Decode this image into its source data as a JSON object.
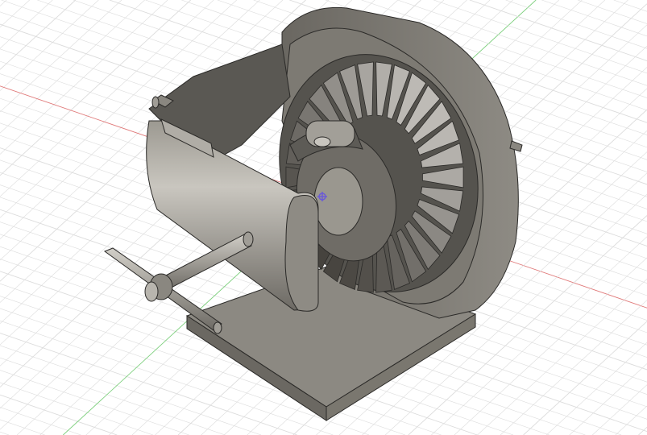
{
  "viewport": {
    "background": "#ffffff",
    "grid_color": "#dcdcdc",
    "x_axis_color": "#e07a7a",
    "y_axis_color": "#7ccf7c",
    "origin_marker_color": "#6b5bd6"
  },
  "model": {
    "name_icon": "differential-gear-assembly-icon",
    "body_color": "#8a8780",
    "light_color": "#bdbab3",
    "dark_color": "#4e4c48",
    "edge_color": "#2b2a28"
  }
}
